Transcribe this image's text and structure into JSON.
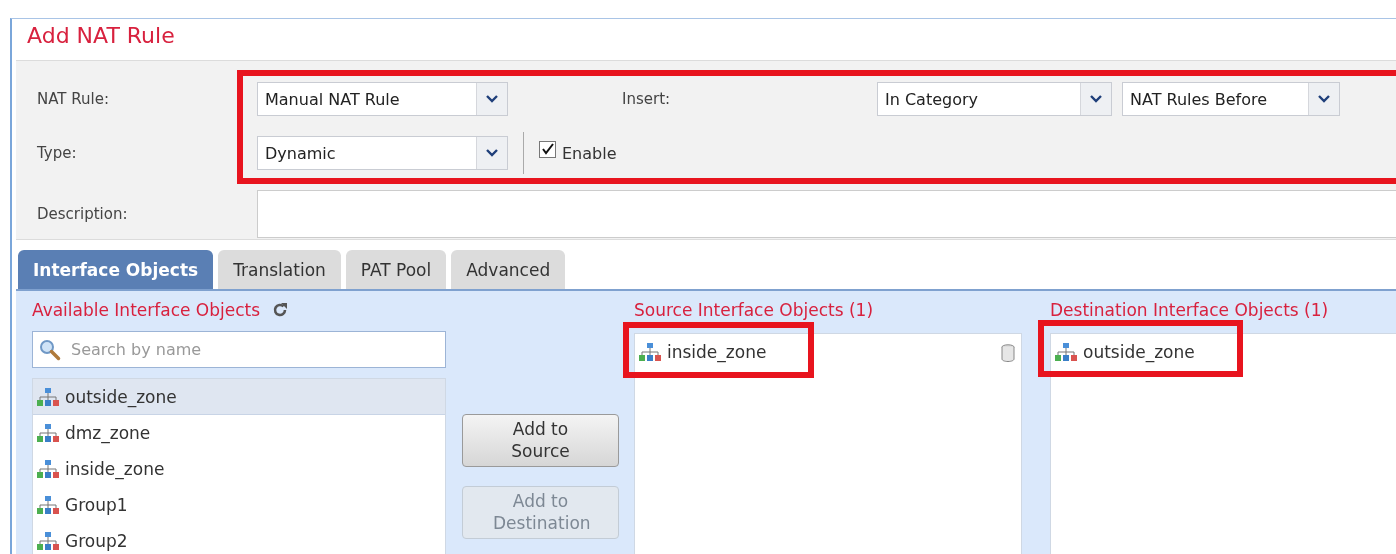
{
  "dialog": {
    "title": "Add NAT Rule"
  },
  "form": {
    "nat_rule": {
      "label": "NAT Rule:",
      "value": "Manual NAT Rule"
    },
    "insert": {
      "label": "Insert:",
      "category": "In Category",
      "position": "NAT Rules Before"
    },
    "type": {
      "label": "Type:",
      "value": "Dynamic"
    },
    "enable": {
      "label": "Enable",
      "checked": true
    },
    "description": {
      "label": "Description:"
    }
  },
  "tabs": [
    {
      "label": "Interface Objects",
      "selected": true
    },
    {
      "label": "Translation",
      "selected": false
    },
    {
      "label": "PAT Pool",
      "selected": false
    },
    {
      "label": "Advanced",
      "selected": false
    }
  ],
  "available": {
    "title": "Available Interface Objects",
    "search": {
      "placeholder": "Search by name"
    },
    "items": [
      {
        "name": "outside_zone",
        "selected": true
      },
      {
        "name": "dmz_zone",
        "selected": false
      },
      {
        "name": "inside_zone",
        "selected": false
      },
      {
        "name": "Group1",
        "selected": false
      },
      {
        "name": "Group2",
        "selected": false
      }
    ]
  },
  "buttons": [
    {
      "label": "Add to Source",
      "disabled": false
    },
    {
      "label": "Add to Destination",
      "disabled": true
    }
  ],
  "source": {
    "title": "Source Interface Objects (1)",
    "items": [
      {
        "name": "inside_zone"
      }
    ]
  },
  "destination": {
    "title": "Destination Interface Objects (1)",
    "items": [
      {
        "name": "outside_zone"
      }
    ]
  }
}
